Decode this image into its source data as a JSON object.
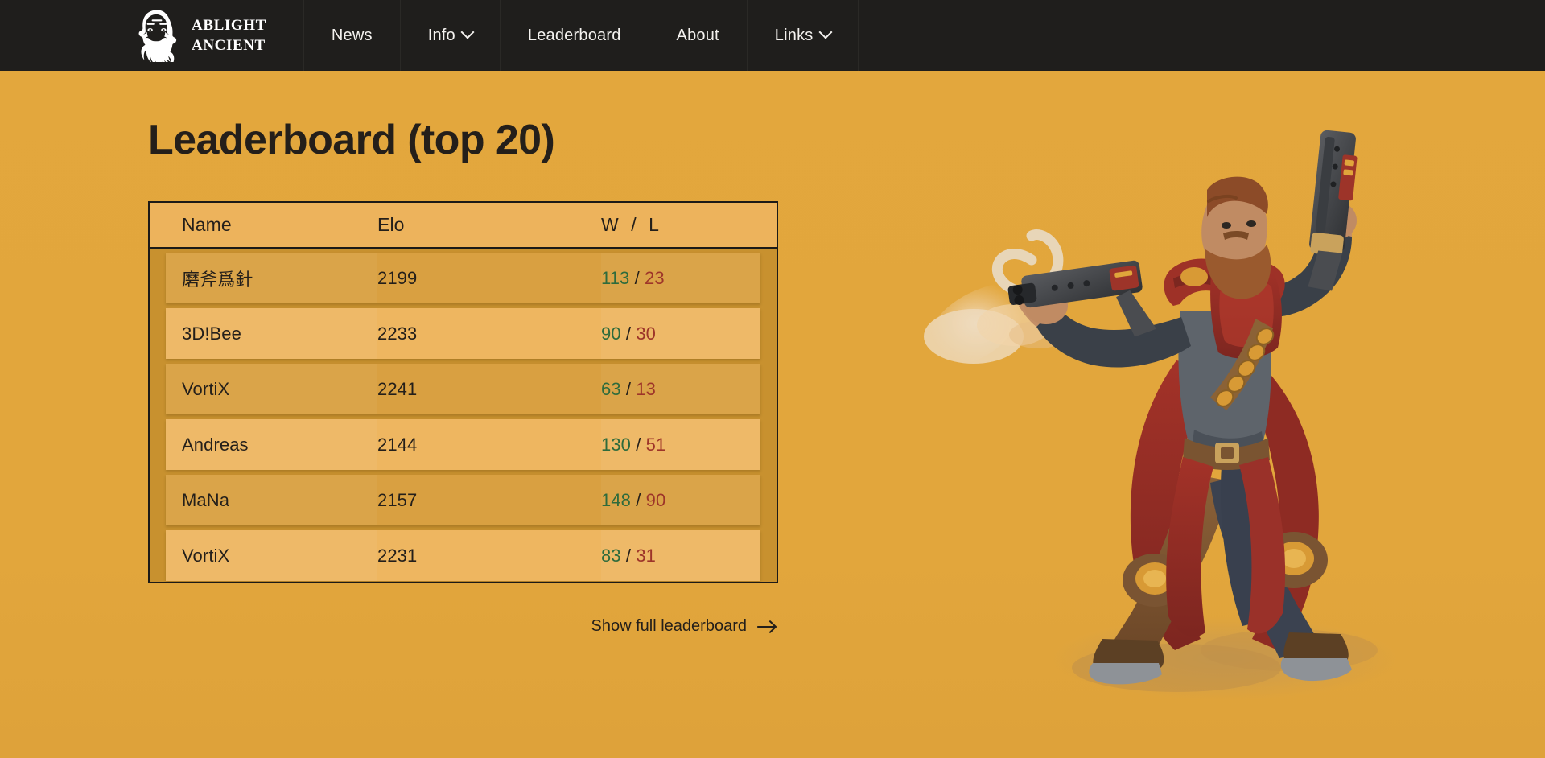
{
  "brand": {
    "icon": "bearded-head-logo",
    "line1": "ABLIGHT",
    "line2": "ANCIENT"
  },
  "nav": {
    "items": [
      {
        "label": "News",
        "name": "nav-item-news",
        "caret": false
      },
      {
        "label": "Info",
        "name": "nav-item-info",
        "caret": true
      },
      {
        "label": "Leaderboard",
        "name": "nav-item-leaderboard",
        "caret": false
      },
      {
        "label": "About",
        "name": "nav-item-about",
        "caret": false
      },
      {
        "label": "Links",
        "name": "nav-item-links",
        "caret": true
      }
    ]
  },
  "main": {
    "title": "Leaderboard (top 20)",
    "show_full_label": "Show full leaderboard"
  },
  "leaderboard": {
    "columns": {
      "name": "Name",
      "elo": "Elo",
      "w": "W",
      "separator": "/",
      "l": "L"
    },
    "rows": [
      {
        "name": "磨斧爲針",
        "elo": "2199",
        "w": "113",
        "sep": "/",
        "l": "23"
      },
      {
        "name": "3D!Bee",
        "elo": "2233",
        "w": "90",
        "sep": "/",
        "l": "30"
      },
      {
        "name": "VortiX",
        "elo": "2241",
        "w": "63",
        "sep": "/",
        "l": "13"
      },
      {
        "name": "Andreas",
        "elo": "2144",
        "w": "130",
        "sep": "/",
        "l": "51"
      },
      {
        "name": "MaNa",
        "elo": "2157",
        "w": "148",
        "sep": "/",
        "l": "90"
      },
      {
        "name": "VortiX",
        "elo": "2231",
        "w": "83",
        "sep": "/",
        "l": "31"
      }
    ]
  },
  "hero": {
    "alt": "gunslinger-character-art"
  },
  "colors": {
    "background": "#E2A63C",
    "navbar": "#1F1E1C",
    "text": "#241F1A",
    "row_dark": "#D9A041",
    "row_light": "#EEB660",
    "header_row": "#EDB35C",
    "win_green": "#2E6B3C",
    "loss_red": "#9D3429"
  }
}
